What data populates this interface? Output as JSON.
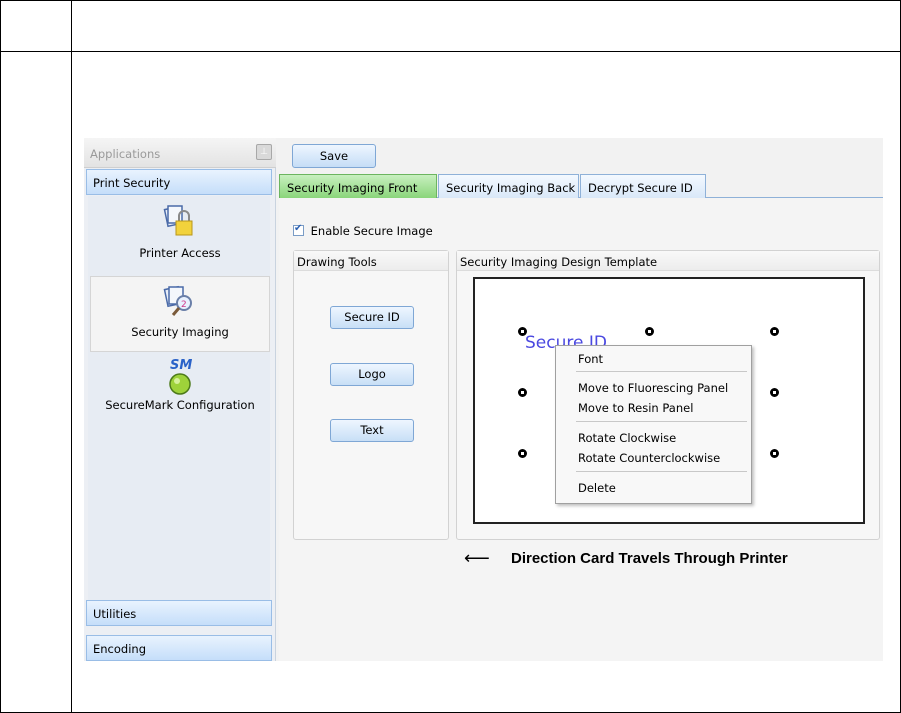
{
  "left_panel": {
    "header": "Applications",
    "print_security": "Print Security",
    "apps": [
      {
        "label": "Printer Access"
      },
      {
        "label": "Security Imaging"
      },
      {
        "label": "SecureMark Configuration"
      }
    ],
    "sm_badge": "SM",
    "utilities": "Utilities",
    "encoding": "Encoding"
  },
  "toolbar": {
    "save_label": "Save"
  },
  "tabs": [
    {
      "label": "Security Imaging Front",
      "active": true
    },
    {
      "label": "Security Imaging Back",
      "active": false
    },
    {
      "label": "Decrypt Secure ID",
      "active": false
    }
  ],
  "enable_secure_image": {
    "label": "Enable Secure Image",
    "checked": true
  },
  "drawing_tools": {
    "title": "Drawing Tools",
    "buttons": [
      "Secure ID",
      "Logo",
      "Text"
    ]
  },
  "design_template": {
    "title": "Security Imaging Design Template",
    "selected_text": "Secure ID"
  },
  "context_menu": {
    "items": [
      "Font",
      "Move to Fluorescing Panel",
      "Move to Resin Panel",
      "Rotate Clockwise",
      "Rotate Counterclockwise",
      "Delete"
    ]
  },
  "direction_caption": "Direction Card Travels Through Printer",
  "direction_arrow": "⟵",
  "colors": {
    "active_tab": "#8ad57a",
    "button_accent": "#c5ddf6",
    "secure_text": "#4a48e0"
  }
}
